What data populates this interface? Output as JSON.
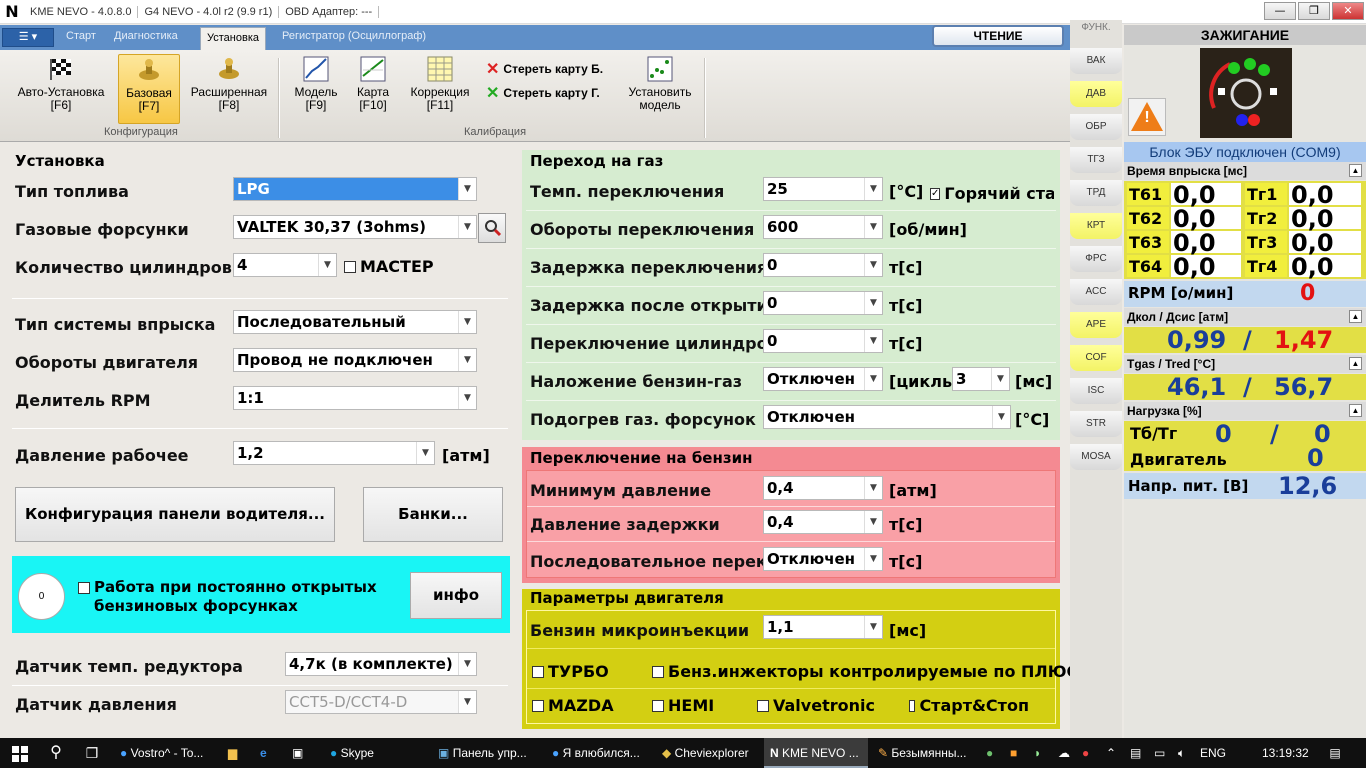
{
  "window": {
    "app_logo": "N",
    "title_segments": [
      "KME NEVO - 4.0.8.0",
      "G4 NEVO - 4.0l r2 (9.9 r1)",
      "OBD Адаптер: ---"
    ],
    "min": "—",
    "max": "❐",
    "close": "✕"
  },
  "tabs": {
    "menu_icon": "☰ ▾",
    "items": [
      "Старт",
      "Диагностика",
      "Установка",
      "Регистратор (Осциллограф)"
    ],
    "active": 2
  },
  "read_button": "ЧТЕНИЕ",
  "ribbon": {
    "config": {
      "auto": [
        "Авто-Установка",
        "[F6]"
      ],
      "base": [
        "Базовая",
        "[F7]"
      ],
      "extended": [
        "Расширенная",
        "[F8]"
      ],
      "group_label": "Конфигурация"
    },
    "calib": {
      "model": [
        "Модель",
        "[F9]"
      ],
      "map": [
        "Карта",
        "[F10]"
      ],
      "correction": [
        "Коррекция",
        "[F11]"
      ],
      "erase_b": "Стереть карту Б.",
      "erase_g": "Стереть карту Г.",
      "set_model": [
        "Установить",
        "модель"
      ],
      "group_label": "Калибрация"
    }
  },
  "install": {
    "title": "Установка",
    "fuel_type_label": "Тип топлива",
    "fuel_type": "LPG",
    "injectors_label": "Газовые форсунки",
    "injectors": "VALTEK 30,37 (3ohms)",
    "cyl_label": "Количество цилиндров",
    "cyl": "4",
    "master": "МАСТЕР",
    "inj_sys_label": "Тип системы впрыска",
    "inj_sys": "Последовательный",
    "rpm_src_label": "Обороты двигателя",
    "rpm_src": "Провод не подключен",
    "rpm_div_label": "Делитель RPM",
    "rpm_div": "1:1",
    "pressure_label": "Давление рабочее",
    "pressure": "1,2",
    "pressure_unit": "[атм]",
    "config_btn": "Конфигурация панели водителя...",
    "banks_btn": "Банки...",
    "gauge_value": "0",
    "open_inj": "Работа при постоянно открытых бензиновых форсунках",
    "info_btn": "инфо",
    "reducer_temp_label": "Датчик темп. редуктора",
    "reducer_temp": "4,7к (в комплекте)",
    "press_sensor_label": "Датчик давления",
    "press_sensor": "CCT5-D/CCT4-D"
  },
  "gas_switch": {
    "title": "Переход на газ",
    "temp_label": "Темп. переключения",
    "temp": "25",
    "temp_unit": "[°C]",
    "hot_start": "Горячий стар",
    "rpm_label": "Обороты переключения",
    "rpm": "600",
    "rpm_unit": "[об/мин]",
    "delay_label": "Задержка переключения",
    "delay": "0",
    "delay_unit": "т[с]",
    "delay_open_label": "Задержка после открытия ",
    "delay_open": "0",
    "delay_open_unit": "т[с]",
    "cyl_sw_label": "Переключение цилиндров",
    "cyl_sw": "0",
    "cyl_sw_unit": "т[с]",
    "overlap_label": "Наложение бензин-газ",
    "overlap": "Отключен",
    "cycles_label": "[циклы",
    "cycles": "3",
    "cycles_unit": "[мс]",
    "heat_label": "Подогрев газ. форсунок",
    "heat": "Отключен",
    "heat_unit": "[°C]"
  },
  "petrol_switch": {
    "title": "Переключение на бензин",
    "minp_label": "Минимум давление",
    "minp": "0,4",
    "minp_unit": "[атм]",
    "pdelay_label": "Давление задержки",
    "pdelay": "0,4",
    "pdelay_unit": "т[с]",
    "seq_label": "Последовательное перекл.",
    "seq": "Отключен",
    "seq_unit": "т[с]"
  },
  "engine": {
    "title": "Параметры двигателя",
    "micro_label": "Бензин микроинъекции",
    "micro": "1,1",
    "micro_unit": "[мс]",
    "turbo": "ТУРБО",
    "plus": "Бенз.инжекторы контролируемые по ПЛЮСУ",
    "mazda": "MAZDA",
    "hemi": "HEMI",
    "valvetronic": "Valvetronic",
    "startstop": "Старт&Стоп"
  },
  "strip": [
    "ФУНК.",
    "ВАК",
    "ДАВ",
    "ОБР",
    "ТГЗ",
    "ТРД",
    "КРТ",
    "ФРС",
    "АСС",
    "АРЕ",
    "COF",
    "ISC",
    "STR",
    "MOSA"
  ],
  "right": {
    "ignition_title": "ЗАЖИГАНИЕ",
    "warning": "!",
    "ecu_status": "Блок ЭБУ подключен (COM9)",
    "inj_time_title": "Время впрыска [мс]",
    "inj": [
      {
        "b": "Т61",
        "bv": "0,0",
        "g": "Тг1",
        "gv": "0,0"
      },
      {
        "b": "Т62",
        "bv": "0,0",
        "g": "Тг2",
        "gv": "0,0"
      },
      {
        "b": "Т63",
        "bv": "0,0",
        "g": "Тг3",
        "gv": "0,0"
      },
      {
        "b": "Т64",
        "bv": "0,0",
        "g": "Тг4",
        "gv": "0,0"
      }
    ],
    "rpm_label": "RPM [о/мин]",
    "rpm": "0",
    "pcoll_title": "Дкол / Дсис [атм]",
    "pcoll": "0,99",
    "psys": "1,47",
    "slash": "/",
    "temp_title": "Tgas / Tred [°C]",
    "tgas": "46,1",
    "tred": "56,7",
    "load_title": "Нагрузка [%]",
    "load_ratio_label": "Тб/Тг",
    "load_b": "0",
    "load_g": "0",
    "load_engine_label": "Двигатель",
    "load_engine": "0",
    "voltage_label": "Напр. пит. [В]",
    "voltage": "12,6"
  },
  "taskbar": {
    "items": [
      "Vostro^ - To...",
      "Панель упр...",
      "Я влюбился...",
      "Cheviexplorer",
      "KME NEVO ...",
      "Безымянны..."
    ],
    "lang": "ENG",
    "time": "13:19:32"
  }
}
